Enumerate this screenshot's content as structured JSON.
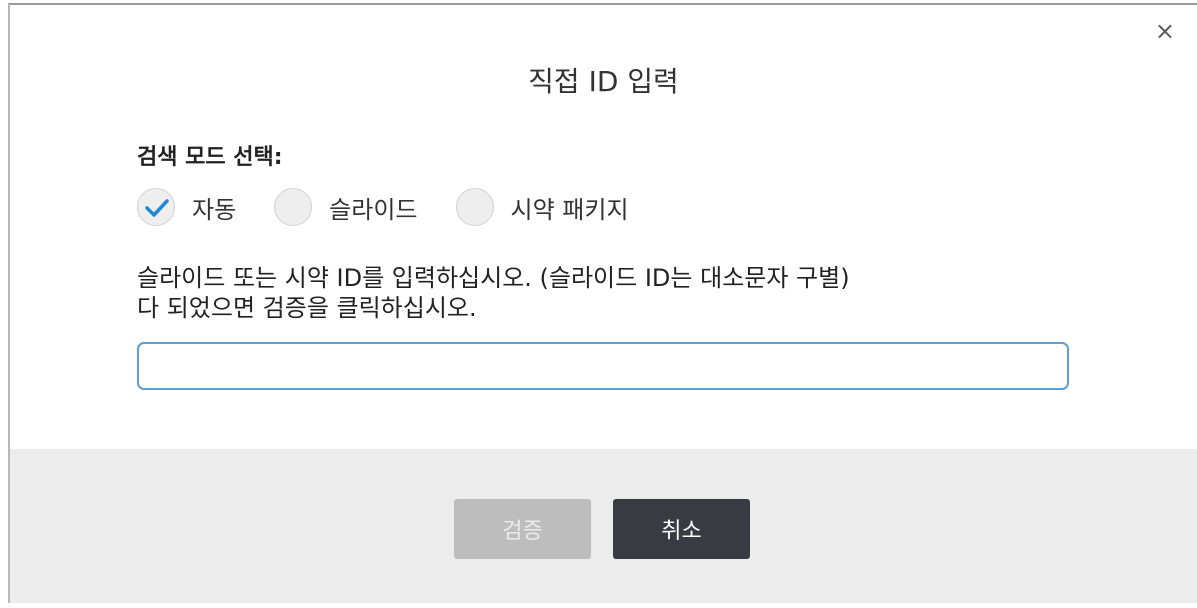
{
  "dialog": {
    "title": "직접 ID 입력",
    "close_symbol": "×"
  },
  "mode": {
    "label": "검색 모드 선택:",
    "options": [
      {
        "label": "자동",
        "checked": true
      },
      {
        "label": "슬라이드",
        "checked": false
      },
      {
        "label": "시약 패키지",
        "checked": false
      }
    ]
  },
  "instructions": {
    "line1": "슬라이드 또는 시약 ID를 입력하십시오. (슬라이드 ID는 대소문자 구별)",
    "line2": "다 되었으면 검증을 클릭하십시오."
  },
  "input": {
    "value": "",
    "placeholder": ""
  },
  "buttons": {
    "verify": "검증",
    "cancel": "취소"
  },
  "colors": {
    "check": "#1e88d8",
    "input_border": "#5b9fd4",
    "footer_bg": "#ececec",
    "verify_disabled": "#bdbdbd",
    "cancel_bg": "#3a3a42"
  }
}
